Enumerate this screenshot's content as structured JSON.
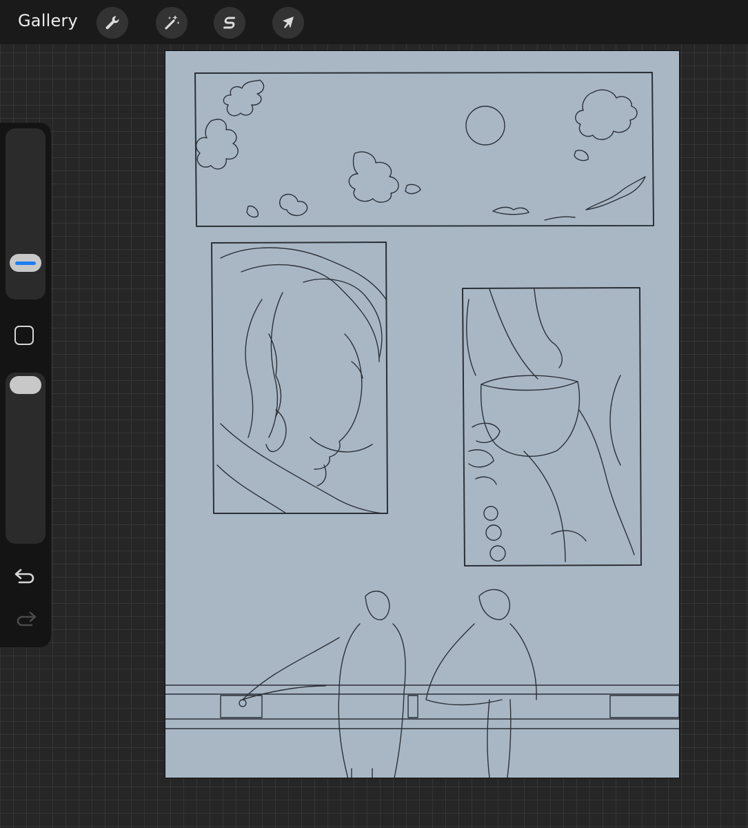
{
  "toolbar": {
    "gallery_label": "Gallery",
    "tools": [
      {
        "name": "actions",
        "icon": "wrench-icon"
      },
      {
        "name": "adjustments",
        "icon": "magic-wand-icon"
      },
      {
        "name": "selection",
        "icon": "selection-s-icon"
      },
      {
        "name": "transform",
        "icon": "arrow-cursor-icon"
      }
    ]
  },
  "sidebar": {
    "brush_size_icon": "brush-size-slider",
    "modify_icon": "square-modify-icon",
    "opacity_icon": "opacity-slider",
    "undo_icon": "undo-icon",
    "redo_icon": "redo-icon"
  },
  "canvas": {
    "background_color": "#a9b7c5",
    "content": "comic-page-sketch"
  },
  "colors": {
    "topbar": "#1a1a1a",
    "accent": "#1a7ff5",
    "workspace": "#262626"
  }
}
